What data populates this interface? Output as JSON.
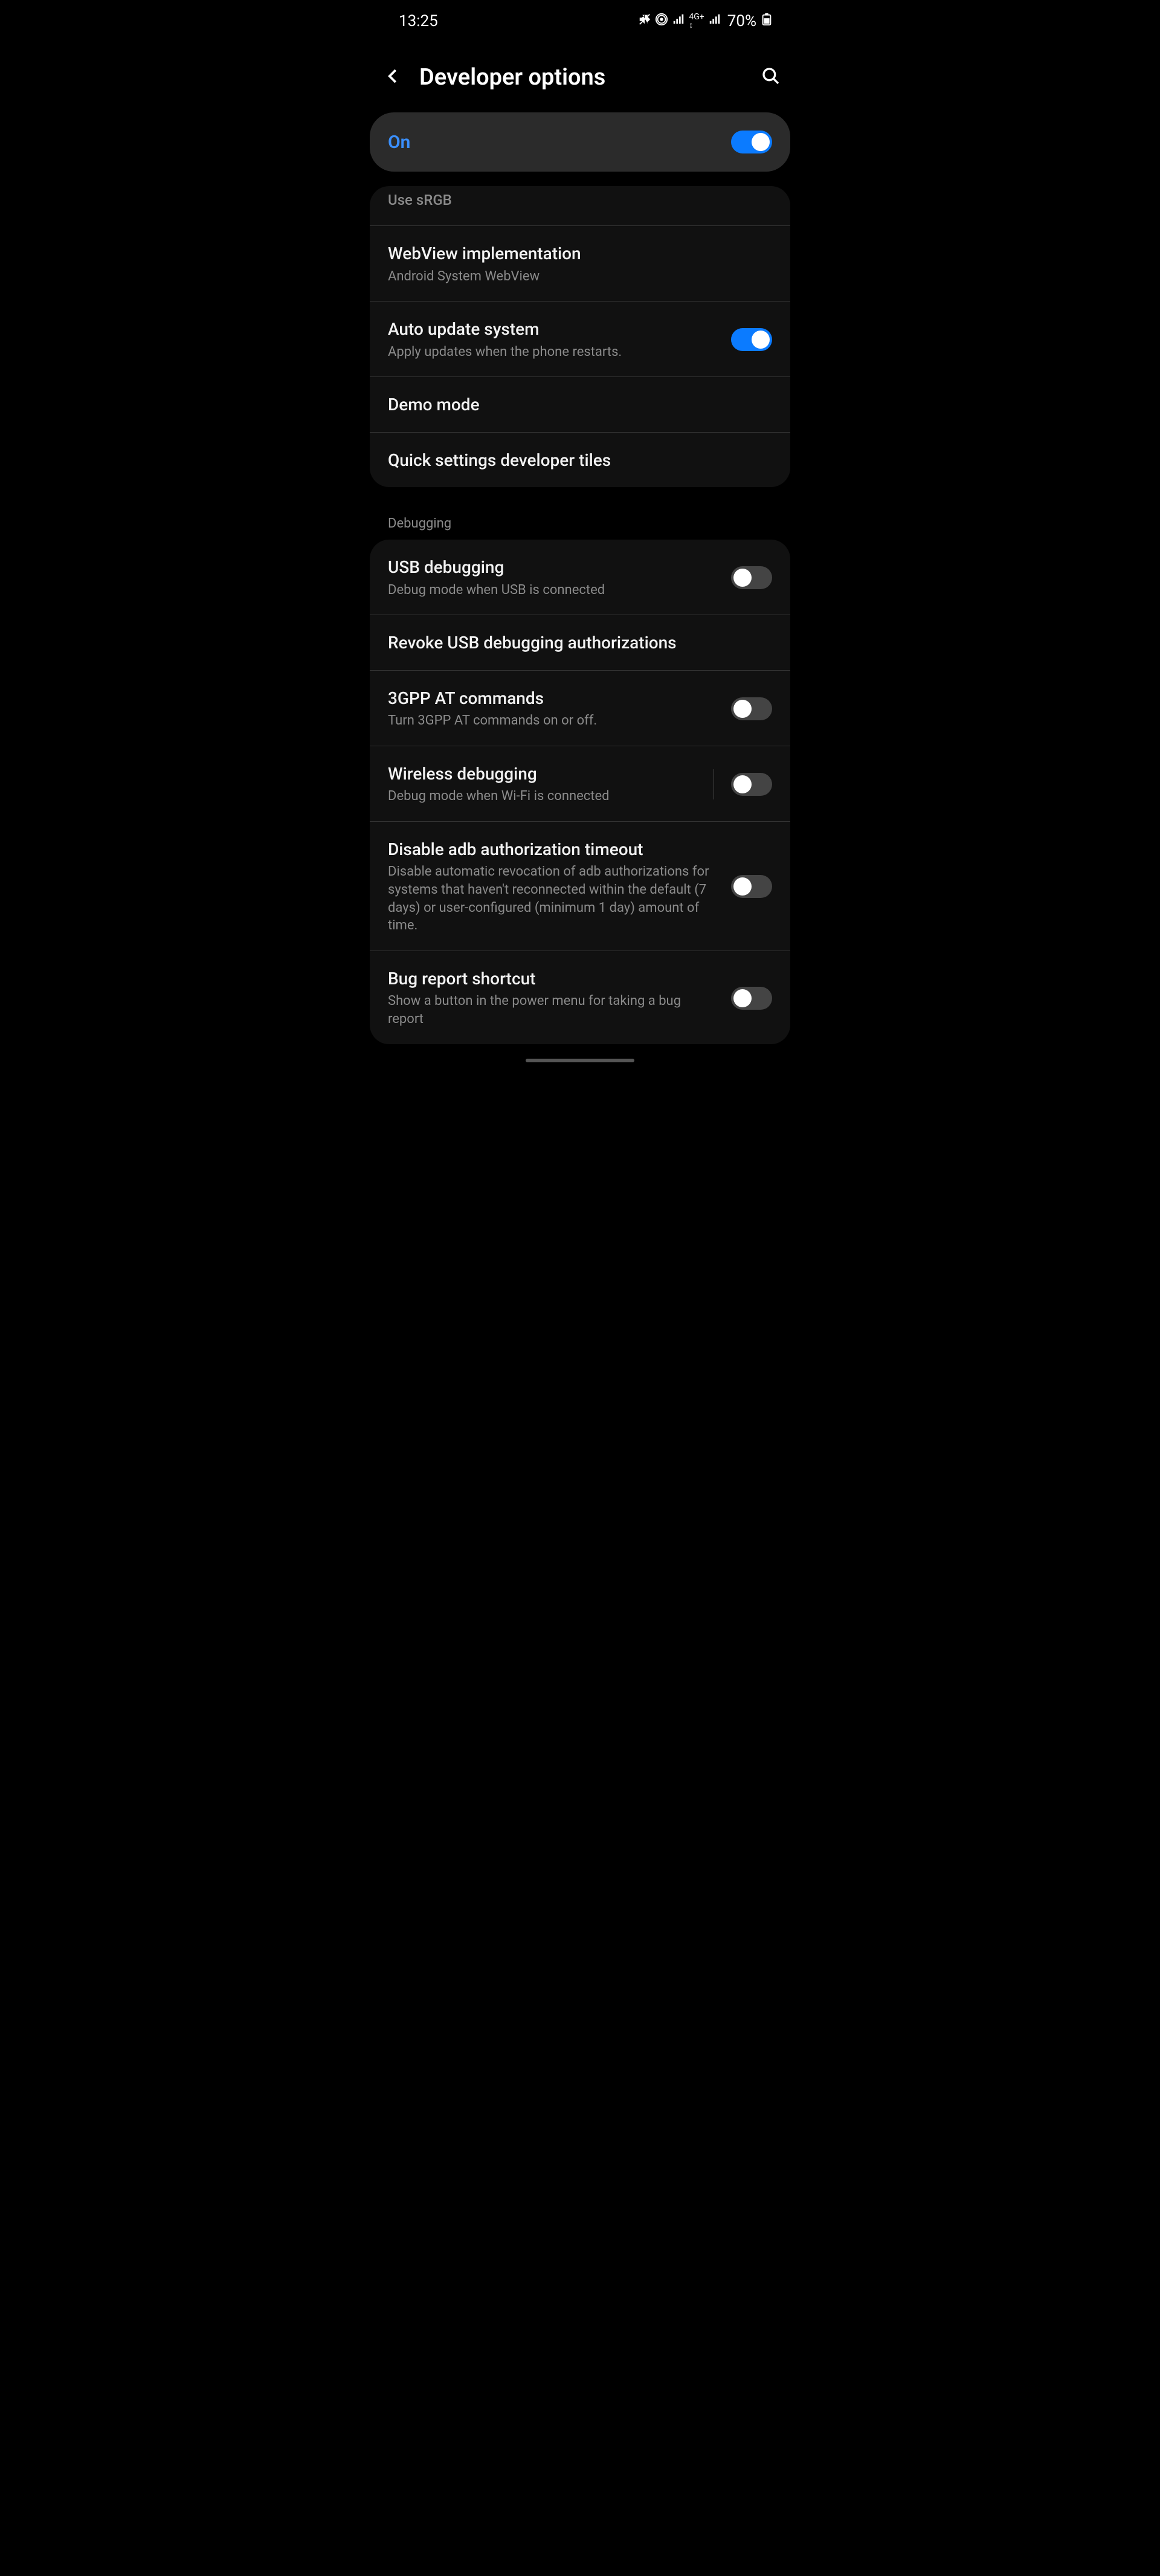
{
  "status": {
    "time": "13:25",
    "battery_pct": "70%"
  },
  "header": {
    "title": "Developer options"
  },
  "master": {
    "label": "On",
    "on": true
  },
  "group1": [
    {
      "title": "Use sRGB",
      "sub": null,
      "toggle": null,
      "cut_top": true,
      "dim": true
    },
    {
      "title": "WebView implementation",
      "sub": "Android System WebView",
      "toggle": null
    },
    {
      "title": "Auto update system",
      "sub": "Apply updates when the phone restarts.",
      "toggle": true
    },
    {
      "title": "Demo mode",
      "sub": null,
      "toggle": null
    },
    {
      "title": "Quick settings developer tiles",
      "sub": null,
      "toggle": null
    }
  ],
  "section2_label": "Debugging",
  "group2": [
    {
      "title": "USB debugging",
      "sub": "Debug mode when USB is connected",
      "toggle": false
    },
    {
      "title": "Revoke USB debugging authorizations",
      "sub": null,
      "toggle": null
    },
    {
      "title": "3GPP AT commands",
      "sub": "Turn 3GPP AT commands on or off.",
      "toggle": false
    },
    {
      "title": "Wireless debugging",
      "sub": "Debug mode when Wi-Fi is connected",
      "toggle": false,
      "divider": true
    },
    {
      "title": "Disable adb authorization timeout",
      "sub": "Disable automatic revocation of adb authorizations for systems that haven't reconnected within the default (7 days) or user-configured (minimum 1 day) amount of time.",
      "toggle": false
    },
    {
      "title": "Bug report shortcut",
      "sub": "Show a button in the power menu for taking a bug report",
      "toggle": false
    }
  ]
}
